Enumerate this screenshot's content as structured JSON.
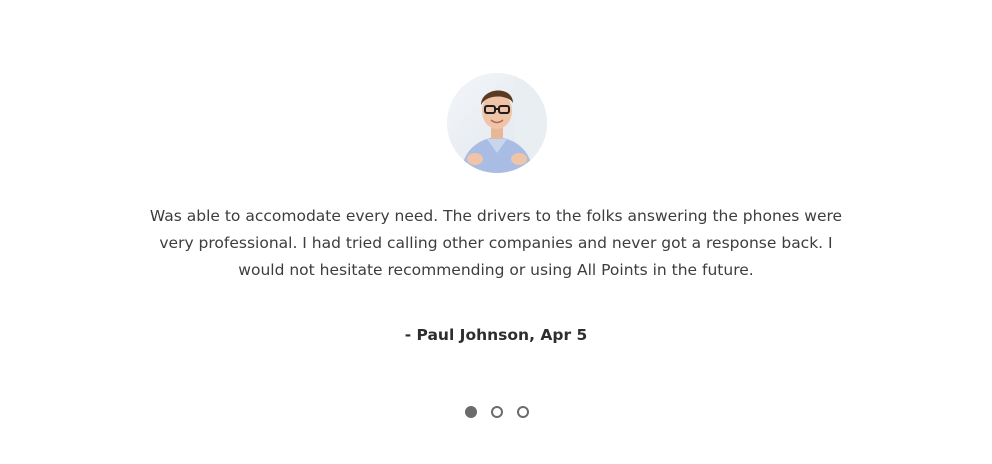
{
  "testimonial": {
    "avatar_name": "avatar",
    "quote": "Was able to accomodate every need. The drivers to the folks answering the phones were very professional. I had tried calling other companies and never got a response back. I would not hesitate recommending or using All Points in the future.",
    "author": "- Paul Johnson, Apr 5"
  },
  "carousel": {
    "slides": 3,
    "active_index": 0
  },
  "colors": {
    "text": "#3d3d3d",
    "author": "#2e2e2e",
    "dot": "#6b6b6b",
    "background": "#ffffff"
  }
}
